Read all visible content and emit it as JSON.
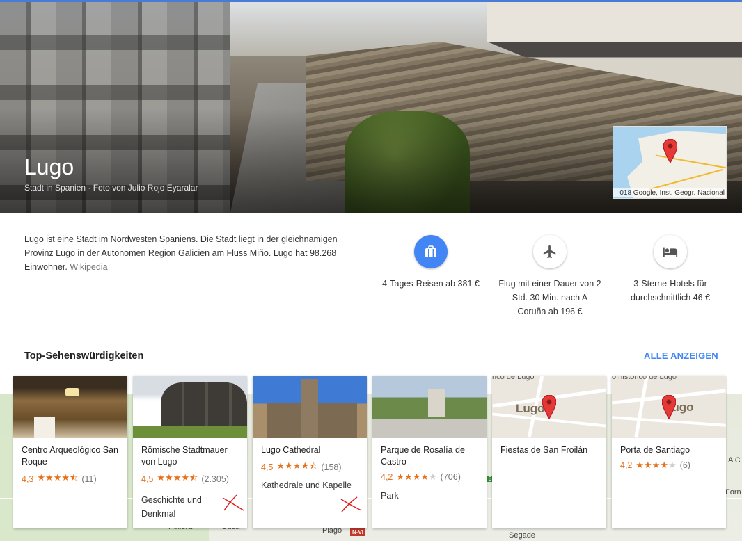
{
  "hero": {
    "title": "Lugo",
    "subtitle": "Stadt in Spanien · Foto von Julio Rojo Eyaralar",
    "map_credit": "018 Google, Inst. Geogr. Nacional"
  },
  "description": {
    "text": "Lugo ist eine Stadt im Nordwesten Spaniens. Die Stadt liegt in der gleichnamigen Provinz Lugo in der Autonomen Region Galicien am Fluss Miño. Lugo hat 98.268 Einwohner.",
    "source": "Wikipedia"
  },
  "actions": [
    {
      "label": "4-Tages-Reisen ab 381 €",
      "icon": "suitcase-icon"
    },
    {
      "label": "Flug mit einer Dauer von 2 Std. 30 Min. nach A Coruña ab 196 €",
      "icon": "airplane-icon"
    },
    {
      "label": "3-Sterne-Hotels für durchschnittlich 46 €",
      "icon": "bed-icon"
    }
  ],
  "attractions": {
    "title": "Top-Sehenswürdigkeiten",
    "see_all": "ALLE ANZEIGEN",
    "cards": [
      {
        "name": "Centro Arqueológico San Roque",
        "score": "4,3",
        "stars": 4.5,
        "count": "(11)",
        "category": ""
      },
      {
        "name": "Römische Stadtmauer von Lugo",
        "score": "4,5",
        "stars": 4.5,
        "count": "(2.305)",
        "category": "Geschichte und Denkmal"
      },
      {
        "name": "Lugo Cathedral",
        "score": "4,5",
        "stars": 4.5,
        "count": "(158)",
        "category": "Kathedrale und Kapelle"
      },
      {
        "name": "Parque de Rosalía de Castro",
        "score": "4,2",
        "stars": 4,
        "count": "(706)",
        "category": "Park"
      },
      {
        "name": "Fiestas de San Froilán",
        "score": "",
        "stars": 0,
        "count": "",
        "category": ""
      },
      {
        "name": "Porta de Santiago",
        "score": "4,2",
        "stars": 4,
        "count": "(6)",
        "category": ""
      }
    ],
    "map_thumb": {
      "label": "Lugo",
      "top_left_5": "rico de Lugo",
      "top_left_6": "o histórico de Lugo"
    }
  },
  "map_labels": {
    "pullera": "Pullera",
    "ousa": "Ousa",
    "piago": "Piago",
    "segade": "Segade",
    "road": "N-VI",
    "three": "3",
    "a_c": "A C",
    "forn": "Forn"
  }
}
